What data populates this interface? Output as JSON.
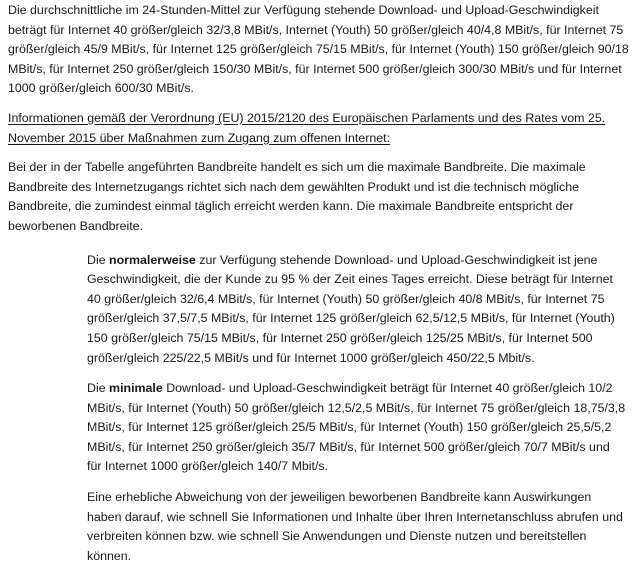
{
  "document": {
    "para_average": "Die durchschnittliche im 24-Stunden-Mittel zur Verfügung stehende Download- und Upload-Geschwindigkeit beträgt für Internet 40 größer/gleich 32/3,8 MBit/s, Internet (Youth) 50 größer/gleich 40/4,8 MBit/s, für Internet 75 größer/gleich 45/9 MBit/s, für Internet 125 größer/gleich 75/15 MBit/s, für Internet (Youth) 150 größer/gleich 90/18 MBit/s, für Internet 250 größer/gleich 150/30 MBit/s, für Internet 500 größer/gleich 300/30 MBit/s und für Internet 1000 größer/gleich 600/30 MBit/s.",
    "heading": "Informationen gemäß der Verordnung (EU) 2015/2120 des Europäischen Parlaments und des Rates vom 25. November 2015 über Maßnahmen zum Zugang zum offenen Internet:",
    "para_bandwidth": "Bei der in der Tabelle angeführten Bandbreite handelt es sich um die maximale Bandbreite. Die maximale Bandbreite des Internetzugangs richtet sich nach dem gewählten Produkt und ist die technisch mögliche Bandbreite, die zumindest einmal täglich erreicht werden kann. Die maximale Bandbreite entspricht der beworbenen Bandbreite.",
    "normal": {
      "prefix": "Die ",
      "bold": "normalerweise",
      "text": " zur Verfügung stehende Download- und Upload-Geschwindigkeit ist jene Geschwindigkeit, die der Kunde zu 95 % der Zeit eines Tages erreicht. Diese beträgt für Internet 40 größer/gleich 32/6,4 MBit/s, für Internet (Youth) 50 größer/gleich 40/8 MBit/s, für Internet 75 größer/gleich 37,5/7,5 MBit/s, für Internet 125 größer/gleich 62,5/12,5 MBit/s, für Internet (Youth) 150 größer/gleich 75/15 MBit/s, für Internet 250 größer/gleich 125/25 MBit/s, für Internet 500 größer/gleich 225/22,5 MBit/s und für Internet 1000 größer/gleich 450/22,5 Mbit/s."
    },
    "minimum": {
      "prefix": "Die ",
      "bold": "minimale",
      "text": " Download- und Upload-Geschwindigkeit beträgt für Internet 40 größer/gleich 10/2 MBit/s, für Internet (Youth) 50 größer/gleich 12,5/2,5 MBit/s, für Internet 75 größer/gleich 18,75/3,8 MBit/s, für Internet 125 größer/gleich 25/5 MBit/s, für Internet (Youth) 150 größer/gleich 25,5/5,2 MBit/s, für Internet 250 größer/gleich 35/7 MBit/s, für Internet 500 größer/gleich 70/7 MBit/s und für Internet 1000 größer/gleich 140/7 Mbit/s."
    },
    "para_deviation": "Eine erhebliche Abweichung von der jeweiligen beworbenen Bandbreite kann Auswirkungen haben darauf, wie schnell Sie Informationen und Inhalte über Ihren Internetanschluss abrufen und verbreiten können bzw. wie schnell Sie Anwendungen und Dienste nutzen und bereitstellen können."
  }
}
